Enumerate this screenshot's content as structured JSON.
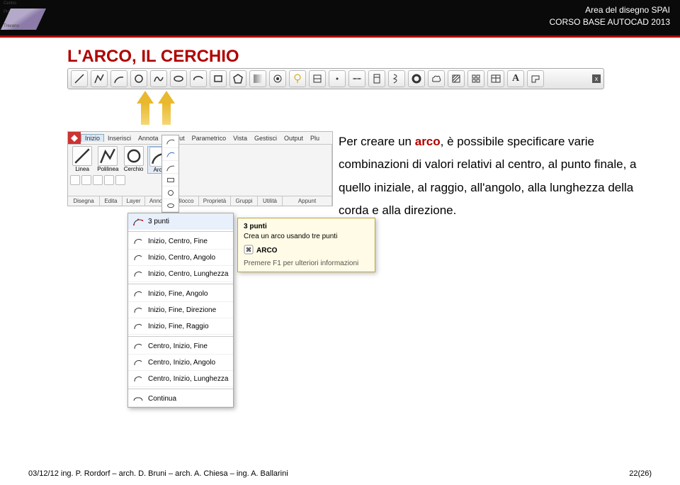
{
  "header": {
    "logo_lines": [
      "Centro",
      "Professionale",
      "Trevano"
    ],
    "right_line1": "Area del disegno SPAI",
    "right_line2": "CORSO BASE AUTOCAD 2013"
  },
  "title": "L'ARCO, IL CERCHIO",
  "toolbar": {
    "items": [
      "line-icon",
      "pline-icon",
      "arc-icon",
      "circle-icon",
      "spline-icon",
      "ellipse-icon",
      "ellipse-arc-icon",
      "rect-icon",
      "polygon-icon",
      "gradient-icon",
      "target-icon",
      "lamp-icon",
      "block-icon",
      "point-icon",
      "divide-icon",
      "measure-icon",
      "helix-icon",
      "donut-icon",
      "cloud-icon",
      "hatch-icon",
      "pattern-icon",
      "table-icon",
      "text-a-icon",
      "region-icon"
    ],
    "close_label": "x"
  },
  "ribbon": {
    "tabs": [
      "Inizio",
      "Inserisci",
      "Annota",
      "Layout",
      "Parametrico",
      "Vista",
      "Gestisci",
      "Output",
      "Plu"
    ],
    "big_icons": {
      "linea": "Linea",
      "polilinea": "Polilinea",
      "cerchio": "Cerchio",
      "arco": "Arco"
    },
    "footer_groups": [
      "Disegna",
      "Edita",
      "Layer",
      "Anno...",
      "Blocco",
      "Proprietà",
      "Gruppi",
      "Utilità",
      "Appunt"
    ]
  },
  "arc_menu": {
    "items": [
      {
        "label": "3 punti",
        "hl": true
      },
      {
        "label": "Inizio, Centro, Fine"
      },
      {
        "label": "Inizio, Centro, Angolo"
      },
      {
        "label": "Inizio, Centro, Lunghezza"
      },
      {
        "label": "Inizio, Fine, Angolo"
      },
      {
        "label": "Inizio, Fine, Direzione"
      },
      {
        "label": "Inizio, Fine, Raggio"
      },
      {
        "label": "Centro, Inizio, Fine"
      },
      {
        "label": "Centro, Inizio, Angolo"
      },
      {
        "label": "Centro, Inizio, Lunghezza"
      },
      {
        "label": "Continua"
      }
    ]
  },
  "tooltip": {
    "title": "3 punti",
    "desc": "Crea un arco usando tre punti",
    "cmd": "ARCO",
    "help": "Premere F1 per ulteriori informazioni"
  },
  "body": {
    "pre": "Per creare un ",
    "arco": "arco",
    "post": ", è possibile specificare varie combinazioni di valori relativi al centro, al punto finale, a quello iniziale, al raggio, all'angolo, alla lunghezza della corda e alla direzione."
  },
  "footer": {
    "left": "03/12/12 ing. P. Rordorf – arch. D. Bruni – arch. A. Chiesa – ing. A. Ballarini",
    "right": "22(26)"
  }
}
